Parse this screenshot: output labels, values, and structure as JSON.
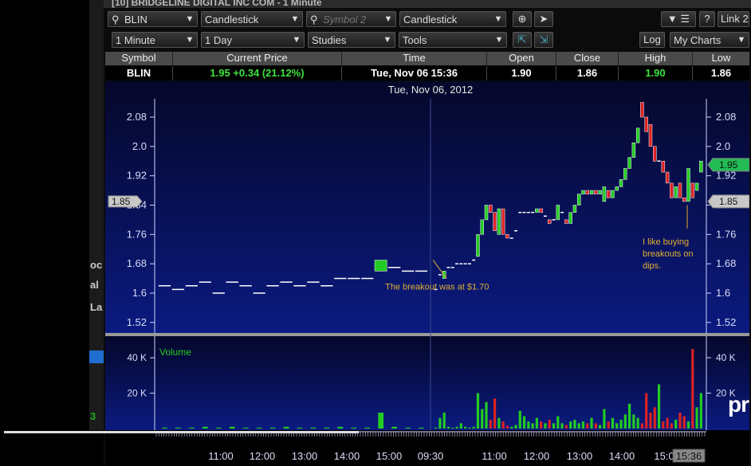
{
  "window": {
    "title": "[10] BRIDGELINE DIGITAL INC COM - 1 Minute",
    "link_label": "Link 2"
  },
  "toolbar": {
    "symbol1": "BLIN",
    "chart_type1": "Candlestick",
    "symbol2_placeholder": "Symbol 2",
    "chart_type2": "Candlestick",
    "interval": "1 Minute",
    "range": "1 Day",
    "studies": "Studies",
    "tools": "Tools",
    "log": "Log",
    "my_charts": "My Charts",
    "help": "?",
    "menu_icon": "list-icon"
  },
  "quote": {
    "headers": [
      "Symbol",
      "Current Price",
      "Time",
      "Open",
      "Close",
      "High",
      "Low"
    ],
    "symbol": "BLIN",
    "current_price": "1.95 +0.34 (21.12%)",
    "time": "Tue, Nov 06 15:36",
    "open": "1.90",
    "close": "1.86",
    "high": "1.90",
    "low": "1.86"
  },
  "left_panel": {
    "texts": [
      "oc",
      "al",
      "La",
      "3"
    ]
  },
  "brand": "pr",
  "colors": {
    "up": "#22cc22",
    "down": "#dd2222",
    "bg_top": "#06082a",
    "bg_bottom": "#0a1a7a",
    "axis": "#cfd6ff",
    "label_gold": "#e0b030"
  },
  "chart_data": {
    "type": "candlestick",
    "title": "Tue, Nov 06, 2012",
    "price_ticks": [
      2.08,
      2.0,
      1.92,
      1.84,
      1.76,
      1.68,
      1.6,
      1.52
    ],
    "price_tick_labels": [
      "2.08",
      "2.0",
      "1.92",
      "1.84",
      "1.76",
      "1.68",
      "1.6",
      "1.52"
    ],
    "ylim": [
      1.5,
      2.13
    ],
    "left_marker": "1.85",
    "right_markers": [
      {
        "label": "1.95",
        "value": 1.95,
        "style": "green"
      },
      {
        "label": "1.85",
        "value": 1.85,
        "style": "gray"
      }
    ],
    "time_ticks": [
      "11:00",
      "12:00",
      "13:00",
      "14:00",
      "15:00",
      "09:30",
      "11:00",
      "12:00",
      "13:00",
      "14:00",
      "15:0",
      "15:36"
    ],
    "volume_label": "Volume",
    "volume_ticks": [
      "40 K",
      "20 K"
    ],
    "volume_tick_values": [
      40000,
      20000
    ],
    "vol_max": 45000,
    "annotations": [
      {
        "text": "The breakout was at $1.70",
        "x_index": 23,
        "y": 1.68
      },
      {
        "text": "I like buying breakouts on dips.",
        "x_index": 94,
        "y": 1.84
      }
    ],
    "day1_series": [
      {
        "o": 1.62,
        "c": 1.62
      },
      {
        "o": 1.61,
        "c": 1.61
      },
      {
        "o": 1.62,
        "c": 1.62
      },
      {
        "o": 1.63,
        "c": 1.63
      },
      {
        "o": 1.6,
        "c": 1.6
      },
      {
        "o": 1.63,
        "c": 1.63
      },
      {
        "o": 1.62,
        "c": 1.62
      },
      {
        "o": 1.6,
        "c": 1.6
      },
      {
        "o": 1.62,
        "c": 1.62
      },
      {
        "o": 1.63,
        "c": 1.63
      },
      {
        "o": 1.62,
        "c": 1.62
      },
      {
        "o": 1.63,
        "c": 1.63
      },
      {
        "o": 1.62,
        "c": 1.62
      },
      {
        "o": 1.64,
        "c": 1.64
      },
      {
        "o": 1.64,
        "c": 1.64
      },
      {
        "o": 1.64,
        "c": 1.64
      },
      {
        "o": 1.66,
        "c": 1.69
      },
      {
        "o": 1.67,
        "c": 1.67
      },
      {
        "o": 1.66,
        "c": 1.66
      },
      {
        "o": 1.66,
        "c": 1.66
      }
    ],
    "day2_series": [
      {
        "o": 1.61,
        "c": 1.61
      },
      {
        "o": 1.65,
        "c": 1.65
      },
      {
        "o": 1.64,
        "c": 1.66
      },
      {
        "o": 1.67,
        "c": 1.67
      },
      {
        "o": 1.67,
        "c": 1.67
      },
      {
        "o": 1.68,
        "c": 1.68
      },
      {
        "o": 1.68,
        "c": 1.68
      },
      {
        "o": 1.68,
        "c": 1.68
      },
      {
        "o": 1.68,
        "c": 1.68
      },
      {
        "o": 1.69,
        "c": 1.69
      },
      {
        "o": 1.7,
        "c": 1.76
      },
      {
        "o": 1.76,
        "c": 1.8
      },
      {
        "o": 1.8,
        "c": 1.84
      },
      {
        "o": 1.84,
        "c": 1.82
      },
      {
        "o": 1.82,
        "c": 1.77
      },
      {
        "o": 1.76,
        "c": 1.83
      },
      {
        "o": 1.83,
        "c": 1.76
      },
      {
        "o": 1.76,
        "c": 1.75
      },
      {
        "o": 1.75,
        "c": 1.75
      },
      {
        "o": 1.77,
        "c": 1.77
      },
      {
        "o": 1.82,
        "c": 1.82
      },
      {
        "o": 1.82,
        "c": 1.82
      },
      {
        "o": 1.82,
        "c": 1.82
      },
      {
        "o": 1.82,
        "c": 1.82
      },
      {
        "o": 1.82,
        "c": 1.83
      },
      {
        "o": 1.83,
        "c": 1.82
      },
      {
        "o": 1.81,
        "c": 1.81
      },
      {
        "o": 1.8,
        "c": 1.79
      },
      {
        "o": 1.8,
        "c": 1.8
      },
      {
        "o": 1.8,
        "c": 1.84
      },
      {
        "o": 1.82,
        "c": 1.82
      },
      {
        "o": 1.8,
        "c": 1.79
      },
      {
        "o": 1.79,
        "c": 1.82
      },
      {
        "o": 1.82,
        "c": 1.84
      },
      {
        "o": 1.84,
        "c": 1.87
      },
      {
        "o": 1.87,
        "c": 1.88
      },
      {
        "o": 1.88,
        "c": 1.87
      },
      {
        "o": 1.87,
        "c": 1.88
      },
      {
        "o": 1.88,
        "c": 1.87
      },
      {
        "o": 1.87,
        "c": 1.88
      },
      {
        "o": 1.85,
        "c": 1.89
      },
      {
        "o": 1.88,
        "c": 1.86
      },
      {
        "o": 1.86,
        "c": 1.88
      },
      {
        "o": 1.88,
        "c": 1.89
      },
      {
        "o": 1.89,
        "c": 1.91
      },
      {
        "o": 1.91,
        "c": 1.94
      },
      {
        "o": 1.94,
        "c": 1.97
      },
      {
        "o": 1.97,
        "c": 2.01
      },
      {
        "o": 2.01,
        "c": 2.05
      },
      {
        "o": 2.12,
        "c": 2.08
      },
      {
        "o": 2.08,
        "c": 2.04
      },
      {
        "o": 2.06,
        "c": 2.0
      },
      {
        "o": 2.0,
        "c": 1.96
      },
      {
        "o": 1.96,
        "c": 1.96
      },
      {
        "o": 1.96,
        "c": 1.93
      },
      {
        "o": 1.93,
        "c": 1.9
      },
      {
        "o": 1.9,
        "c": 1.86
      },
      {
        "o": 1.86,
        "c": 1.89
      },
      {
        "o": 1.9,
        "c": 1.86
      },
      {
        "o": 1.86,
        "c": 1.85
      },
      {
        "o": 1.85,
        "c": 1.94
      },
      {
        "o": 1.9,
        "c": 1.86
      },
      {
        "o": 1.88,
        "c": 1.9
      },
      {
        "o": 1.93,
        "c": 1.96
      }
    ],
    "day1_volume": [
      500,
      500,
      500,
      1000,
      500,
      1000,
      500,
      500,
      500,
      1000,
      500,
      500,
      500,
      1000,
      500,
      500,
      9000,
      1000,
      500,
      500
    ],
    "day2_volume": [
      500,
      6000,
      9000,
      1000,
      500,
      1000,
      3000,
      1000,
      500,
      1000,
      20000,
      11000,
      15000,
      5000,
      17000,
      6000,
      4000,
      1500,
      1000,
      2000,
      10000,
      7000,
      4000,
      3000,
      6000,
      4000,
      3000,
      5000,
      3000,
      7000,
      3000,
      2000,
      4000,
      5000,
      3000,
      4000,
      3000,
      6000,
      3000,
      2000,
      11000,
      4000,
      6000,
      3000,
      5000,
      8000,
      14000,
      8000,
      6000,
      3000,
      20000,
      9000,
      12000,
      25000,
      4000,
      6000,
      3000,
      5000,
      9000,
      7000,
      4000,
      45000,
      12000,
      20000
    ]
  }
}
